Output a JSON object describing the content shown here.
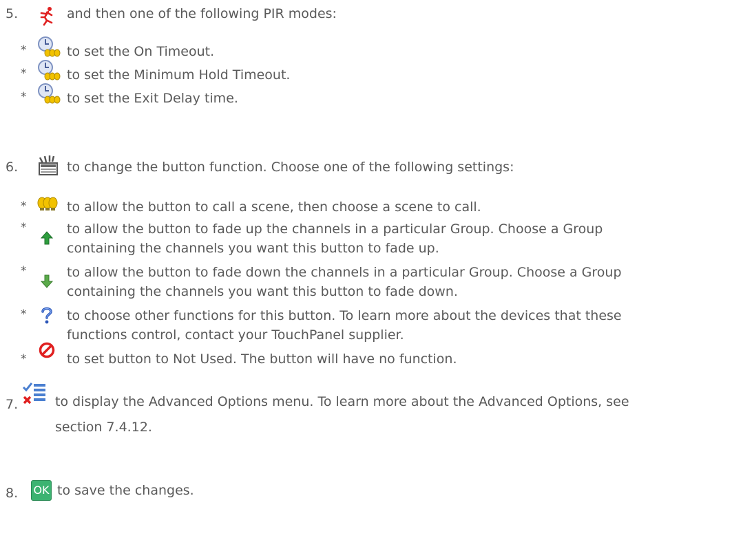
{
  "steps": {
    "s5": {
      "num": "5.",
      "text": "and then one of the following PIR modes:",
      "icon": "running-person-icon",
      "items": [
        {
          "bullet": "*",
          "icon": "timer-scene-icon",
          "text": "to set the On Timeout."
        },
        {
          "bullet": "*",
          "icon": "timer-scene-icon",
          "text": "to set the Minimum Hold Timeout."
        },
        {
          "bullet": "*",
          "icon": "timer-scene-icon",
          "text": "to set the Exit Delay time."
        }
      ]
    },
    "s6": {
      "num": "6.",
      "text": "to change the button function. Choose one of the following settings:",
      "icon": "clapperboard-icon",
      "items": [
        {
          "bullet": "*",
          "icon": "scene-bulbs-icon",
          "line1": "to allow the button to call a scene, then choose a scene to call.",
          "line2": ""
        },
        {
          "bullet": "*",
          "icon": "arrow-up-icon",
          "line1": "to allow the button to fade up the channels in a particular Group. Choose a Group",
          "line2": "containing the channels you want this button to fade up."
        },
        {
          "bullet": "*",
          "icon": "arrow-down-icon",
          "line1": "to allow the button to fade down the channels in a particular Group. Choose a Group",
          "line2": "containing the channels you want this button to fade down."
        },
        {
          "bullet": "*",
          "icon": "question-icon",
          "line1": "to choose other functions for this button. To learn more about the devices that these",
          "line2": "functions control, contact your TouchPanel supplier."
        },
        {
          "bullet": "*",
          "icon": "not-used-icon",
          "line1": "to set button to Not Used. The button will have no function.",
          "line2": ""
        }
      ]
    },
    "s7": {
      "num": "7.",
      "icon": "advanced-options-icon",
      "line1": "to display the Advanced Options menu. To learn more about the Advanced Options, see",
      "line2": "section 7.4.12."
    },
    "s8": {
      "num": "8.",
      "icon": "ok-icon",
      "icon_label": "OK",
      "text": "to save the changes."
    }
  },
  "colors": {
    "text": "#5a5a5a",
    "ok_green": "#3cb371",
    "arrow_up_green": "#2e9e3e",
    "prohibit_red": "#e02020",
    "bulb_yellow": "#f2c200"
  }
}
